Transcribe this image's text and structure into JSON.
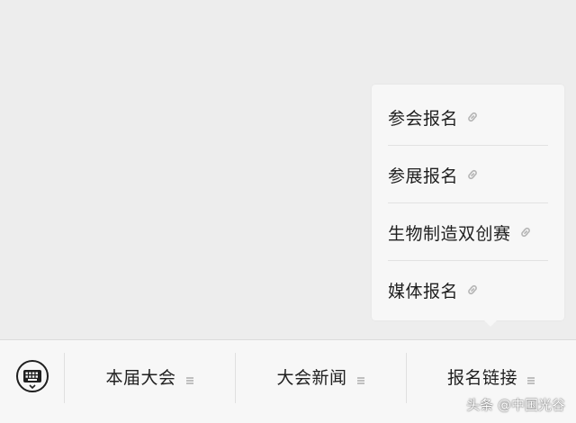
{
  "popup_menu": {
    "items": [
      {
        "label": "参会报名",
        "icon": "link-icon"
      },
      {
        "label": "参展报名",
        "icon": "link-icon"
      },
      {
        "label": "生物制造双创赛",
        "icon": "link-icon"
      },
      {
        "label": "媒体报名",
        "icon": "link-icon"
      }
    ]
  },
  "bottom_bar": {
    "keyboard_icon": "keyboard-icon",
    "tabs": [
      {
        "label": "本届大会",
        "icon": "menu-lines-icon"
      },
      {
        "label": "大会新闻",
        "icon": "menu-lines-icon"
      },
      {
        "label": "报名链接",
        "icon": "menu-lines-icon"
      }
    ]
  },
  "watermark": "头条 @中国光谷",
  "colors": {
    "background": "#ededed",
    "panel": "#f7f7f7",
    "text": "#1f1f1f",
    "icon": "#b5b5b5"
  }
}
